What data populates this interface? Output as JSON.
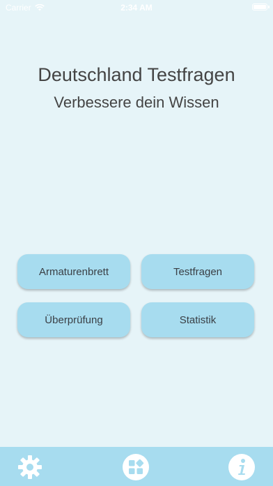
{
  "status_bar": {
    "carrier": "Carrier",
    "time": "2:34 AM"
  },
  "header": {
    "title": "Deutschland Testfragen",
    "subtitle": "Verbessere dein Wissen"
  },
  "menu": {
    "dashboard": "Armaturenbrett",
    "questions": "Testfragen",
    "review": "Überprüfung",
    "statistics": "Statistik"
  },
  "tab_bar": {
    "icons": [
      "gear-icon",
      "apps-grid-icon",
      "info-icon"
    ]
  },
  "colors": {
    "background": "#e6f4f8",
    "accent": "#a7dcef",
    "icon": "#ffffff"
  }
}
